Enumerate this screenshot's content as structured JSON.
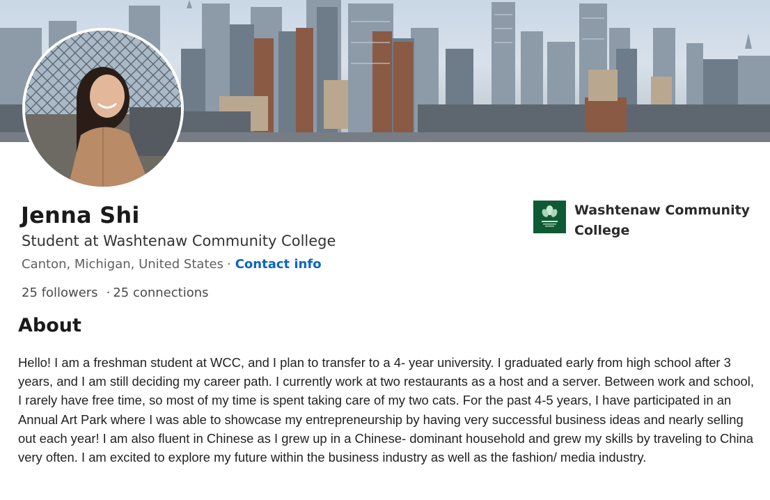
{
  "profile": {
    "name": "Jenna Shi",
    "headline": "Student at Washtenaw Community College",
    "location": "Canton, Michigan, United States",
    "location_separator": "·",
    "contact_label": "Contact info",
    "followers": "25 followers",
    "stats_separator": "·",
    "connections": "25 connections"
  },
  "company": {
    "name": "Washtenaw Community College",
    "logo_icon": "college-logo-icon",
    "logo_color": "#0f5a34"
  },
  "about": {
    "heading": "About",
    "text": "Hello! I am a freshman student at WCC, and I plan to transfer to a 4- year university. I graduated early from high school after 3 years, and I am still deciding my career path. I currently work at two restaurants as a host and a server. Between work and school, I rarely have free time, so most of my time is spent taking care of my two cats. For the past 4-5 years, I have participated in an Annual Art Park where I was able to showcase my entrepreneurship by having very successful business ideas and nearly selling out each year! I am also fluent in Chinese as I grew up in a Chinese- dominant household and grew my skills by traveling to China very often. I am excited to explore my future within the business industry as well as the fashion/ media industry."
  },
  "colors": {
    "link": "#0a66c2",
    "name_text": "#1a1a1a"
  },
  "icons": {
    "banner": "city-skyline-banner",
    "avatar": "profile-photo-avatar"
  }
}
